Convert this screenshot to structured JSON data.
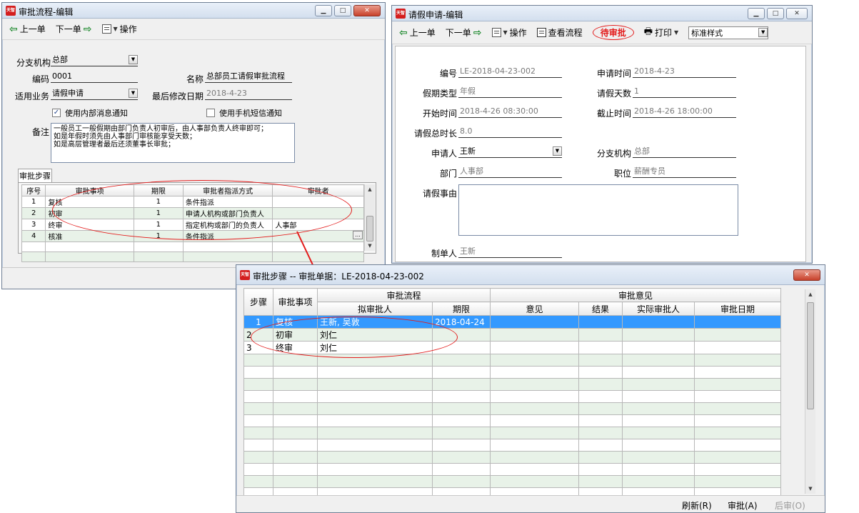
{
  "app_logo": "天智",
  "workflow_window": {
    "title": "审批流程-编辑",
    "toolbar": {
      "prev": "上一单",
      "next": "下一单",
      "ops": "操作"
    },
    "fields": {
      "branch_label": "分支机构",
      "branch_value": "总部",
      "code_label": "编码",
      "code_value": "0001",
      "name_label": "名称",
      "name_value": "总部员工请假审批流程",
      "business_label": "适用业务",
      "business_value": "请假申请",
      "modified_label": "最后修改日期",
      "modified_value": "2018-4-23",
      "internal_msg_label": "使用内部消息通知",
      "sms_label": "使用手机短信通知",
      "note_label": "备注",
      "note_lines": [
        "一般员工一般假期由部门负责人初审后，由人事部负责人终审即可；",
        "如是年假时须先由人事部门审核能享受天数；",
        "如是高层管理者最后还须董事长审批；"
      ]
    },
    "tab_label": "审批步骤",
    "grid": {
      "headers": [
        "序号",
        "审批事项",
        "期限",
        "审批者指派方式",
        "审批者"
      ],
      "rows": [
        [
          "1",
          "复核",
          "1",
          "条件指派",
          ""
        ],
        [
          "2",
          "初审",
          "1",
          "申请人机构或部门负责人",
          ""
        ],
        [
          "3",
          "终审",
          "1",
          "指定机构或部门的负责人",
          "人事部"
        ],
        [
          "4",
          "核准",
          "1",
          "条件指派",
          ""
        ]
      ],
      "ellipsis": "..."
    }
  },
  "leave_window": {
    "title": "请假申请-编辑",
    "toolbar": {
      "prev": "上一单",
      "next": "下一单",
      "ops": "操作",
      "view_flow": "查看流程",
      "status": "待审批",
      "print": "打印",
      "print_style": "标准样式"
    },
    "fields": {
      "no_label": "编号",
      "no_value": "LE-2018-04-23-002",
      "apply_time_label": "申请时间",
      "apply_time_value": "2018-4-23",
      "type_label": "假期类型",
      "type_value": "年假",
      "days_label": "请假天数",
      "days_value": "1",
      "start_label": "开始时间",
      "start_value": "2018-4-26 08:30:00",
      "end_label": "截止时间",
      "end_value": "2018-4-26 18:00:00",
      "total_label": "请假总时长",
      "total_value": "8.0",
      "applicant_label": "申请人",
      "applicant_value": "王新",
      "branch_label": "分支机构",
      "branch_value": "总部",
      "dept_label": "部门",
      "dept_value": "人事部",
      "position_label": "职位",
      "position_value": "薪酬专员",
      "reason_label": "请假事由",
      "maker_label": "制单人",
      "maker_value": "王新"
    }
  },
  "steps_window": {
    "title": "审批步骤 -- 审批单据：LE-2018-04-23-002",
    "headers_top": {
      "step": "步骤",
      "item": "审批事项",
      "flow": "审批流程",
      "opinion": "审批意见"
    },
    "headers_sub": [
      "拟审批人",
      "期限",
      "意见",
      "结果",
      "实际审批人",
      "审批日期"
    ],
    "rows": [
      [
        "1",
        "复核",
        "王新, 吴敦",
        "2018-04-24",
        "",
        "",
        "",
        ""
      ],
      [
        "2",
        "初审",
        "刘仁",
        "",
        "",
        "",
        "",
        ""
      ],
      [
        "3",
        "终审",
        "刘仁",
        "",
        "",
        "",
        "",
        ""
      ]
    ],
    "buttons": {
      "refresh": "刷新(R)",
      "approve": "审批(A)",
      "post_approve": "后审(O)"
    }
  },
  "colors": {
    "highlight": "#3399ff",
    "annotation": "#e31b1b",
    "row_alt": "#e8f2e8"
  }
}
